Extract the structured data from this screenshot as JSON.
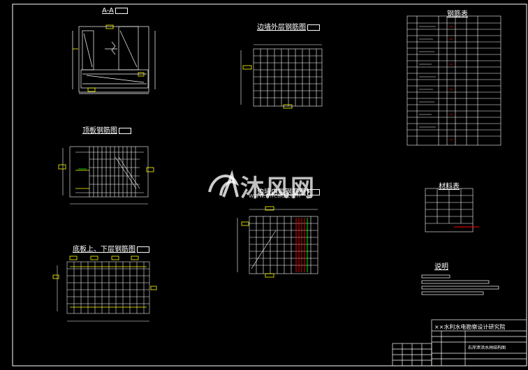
{
  "drawing": {
    "views": {
      "section_aa": "A-A",
      "side_wall_outer": "边墙外层钢筋图",
      "top_slab": "顶板钢筋图",
      "side_wall_inner": "边墙内层钢筋图",
      "bottom_slab": "底板上、下层钢筋图"
    },
    "tables": {
      "rebar_table": "钢筋表",
      "material_table": "材料表",
      "notes": "说明"
    },
    "title_block": {
      "institute": "××水利水电勘察设计研究院",
      "drawing_name": "右岸泄洪水闸结构图"
    },
    "watermark": {
      "brand": "沐风网",
      "url": "www.mfcad.com"
    },
    "colors": {
      "background": "#000000",
      "line": "#ffffff",
      "accent_yellow": "#ffff00",
      "accent_red": "#ff0000",
      "accent_green": "#00ff00",
      "accent_cyan": "#00ffff"
    }
  }
}
